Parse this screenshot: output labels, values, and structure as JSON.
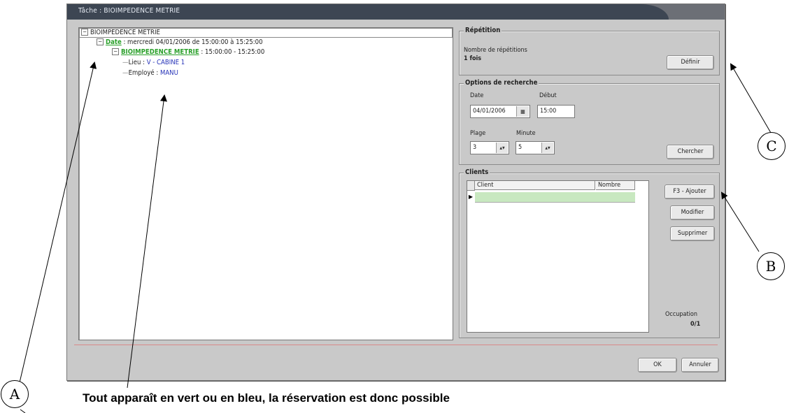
{
  "window": {
    "title": "Tâche : BIOIMPEDENCE METRIE"
  },
  "tree": {
    "root": "BIOIMPEDENCE METRIE",
    "date_label": "Date",
    "date_value": " : mercredi 04/01/2006 de 15:00:00 à 15:25:00",
    "task_label": "BIOIMPEDENCE METRIE",
    "task_value": " : 15:00:00 - 15:25:00",
    "lieu_label": "Lieu : ",
    "lieu_value": "V - CABINE 1",
    "employe_label": "Employé : ",
    "employe_value": "MANU"
  },
  "repetition": {
    "title": "Répétition",
    "count_label": "Nombre de répétitions",
    "count_value": "1 fois",
    "define_button": "Définir"
  },
  "search": {
    "title": "Options de recherche",
    "date_label": "Date",
    "date_value": "04/01/2006",
    "start_label": "Début",
    "start_value": "15:00",
    "range_label": "Plage",
    "range_value": "3",
    "minute_label": "Minute",
    "minute_value": "5",
    "search_button": "Chercher"
  },
  "clients": {
    "title": "Clients",
    "columns": [
      "Client",
      "Nombre"
    ],
    "add_button": "F3 - Ajouter",
    "edit_button": "Modifier",
    "delete_button": "Supprimer",
    "occupation_label": "Occupation",
    "occupation_value": "0/1"
  },
  "footer": {
    "ok_button": "OK",
    "cancel_button": "Annuler"
  },
  "annotations": {
    "a": "A",
    "b": "B",
    "c": "C",
    "caption": "Tout apparaît en vert ou en bleu, la réservation est donc possible"
  },
  "colors": {
    "green": "#2aa02a",
    "blue": "#2633b8",
    "selected_row": "#c8e8c0"
  }
}
